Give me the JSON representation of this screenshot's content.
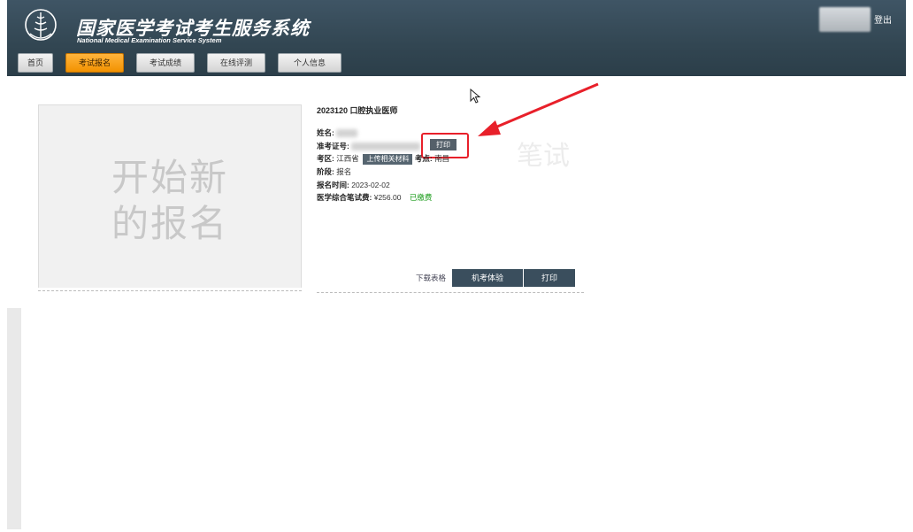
{
  "header": {
    "title": "国家医学考试考生服务系统",
    "subtitle": "National Medical Examination Service System",
    "logout": "登出"
  },
  "nav": {
    "tabs": [
      {
        "label": "首页",
        "active": false
      },
      {
        "label": "考试报名",
        "active": true
      },
      {
        "label": "考试成绩",
        "active": false
      },
      {
        "label": "在线评测",
        "active": false
      },
      {
        "label": "个人信息",
        "active": false
      }
    ]
  },
  "new_registration": {
    "line1": "开始新",
    "line2": "的报名"
  },
  "exam_card": {
    "title": "2023120 口腔执业医师",
    "name_label": "姓名:",
    "ticket_label": "准考证号:",
    "ticket_print": "打印",
    "region_label": "考区:",
    "region_value": "江西省",
    "upload_button": "上传相关材料",
    "site_label": "考点:",
    "site_value": "南昌",
    "stage_label": "阶段:",
    "stage_value": "报名",
    "time_label": "报名时间:",
    "time_value": "2023-02-02",
    "fee_label": "医学综合笔试费:",
    "fee_value": "¥256.00",
    "fee_status": "已缴费",
    "watermark": "笔试",
    "download_link": "下载表格",
    "simulation_button": "机考体验",
    "print_button": "打印"
  },
  "colors": {
    "header_bg": "#324652",
    "active_tab": "#f29200",
    "highlight": "#e8202a",
    "paid": "#1a9b1a",
    "dark_button": "#3a4e5d"
  }
}
